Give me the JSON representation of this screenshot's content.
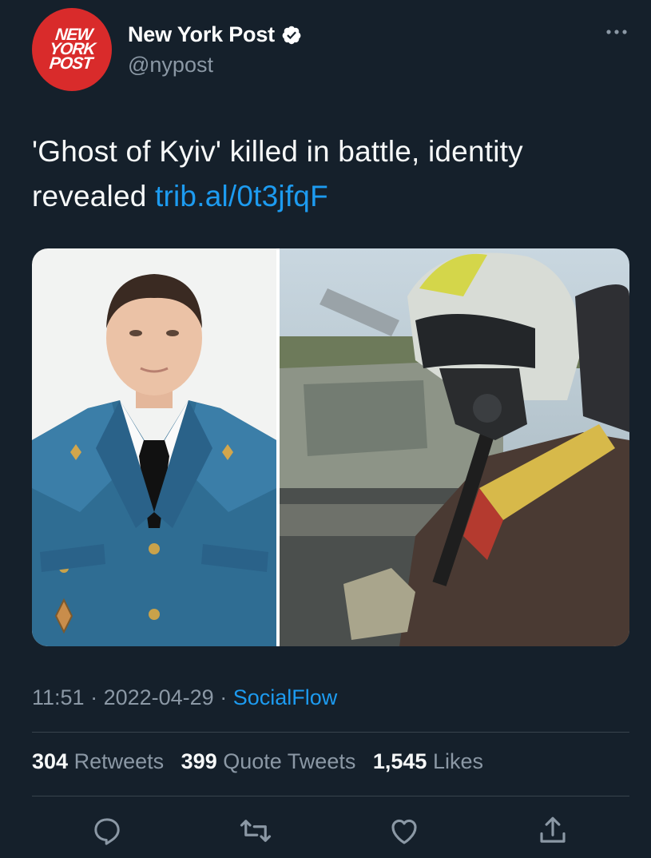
{
  "author": {
    "display_name": "New York Post",
    "handle": "@nypost",
    "avatar_logo_lines": [
      "NEW",
      "YORK",
      "POST"
    ],
    "verified_icon": "verified-badge-icon",
    "avatar_color": "#d92b2b"
  },
  "tweet": {
    "text": "'Ghost of Kyiv' killed in battle, identity revealed ",
    "link": "trib.al/0t3jfqF"
  },
  "media": {
    "left_photo": "portrait of man in blue military uniform",
    "right_photo": "pilot in helmet and oxygen mask in fighter jet cockpit"
  },
  "meta": {
    "time": "11:51",
    "sep1": " · ",
    "date": "2022-04-29",
    "sep2": " · ",
    "source": "SocialFlow"
  },
  "stats": {
    "retweets_count": "304",
    "retweets_label": "Retweets",
    "quotes_count": "399",
    "quotes_label": "Quote Tweets",
    "likes_count": "1,545",
    "likes_label": "Likes"
  },
  "actions": {
    "reply_icon": "reply-icon",
    "retweet_icon": "retweet-icon",
    "like_icon": "like-icon",
    "share_icon": "share-icon"
  },
  "colors": {
    "background": "#15202b",
    "accent": "#1d9bf0",
    "secondary_text": "#8b98a5",
    "divider": "#38444d"
  }
}
